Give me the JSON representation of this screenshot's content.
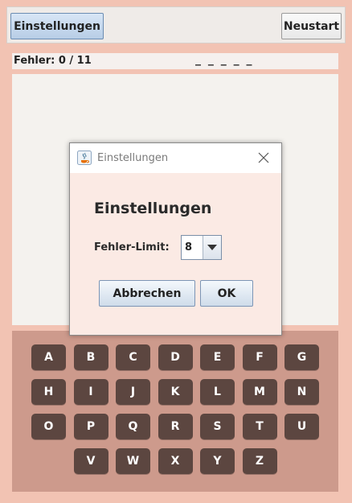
{
  "toolbar": {
    "settings_label": "Einstellungen",
    "restart_label": "Neustart"
  },
  "status": {
    "errors_label": "Fehler: 0 / 11",
    "word_display": "_ _ _ _ _"
  },
  "keyboard": {
    "rows": [
      [
        "A",
        "B",
        "C",
        "D",
        "E",
        "F",
        "G"
      ],
      [
        "H",
        "I",
        "J",
        "K",
        "L",
        "M",
        "N"
      ],
      [
        "O",
        "P",
        "Q",
        "R",
        "S",
        "T",
        "U"
      ],
      [
        "V",
        "W",
        "X",
        "Y",
        "Z"
      ]
    ]
  },
  "dialog": {
    "window_title": "Einstellungen",
    "heading": "Einstellungen",
    "limit_label": "Fehler-Limit:",
    "limit_value": "8",
    "cancel_label": "Abbrechen",
    "ok_label": "OK",
    "close_icon": "close-icon",
    "app_icon": "java-icon"
  },
  "colors": {
    "background": "#f2c3b3",
    "keyboard_bg": "#cd9a8c",
    "key_bg": "#5c4640",
    "dialog_bg": "#fbeae4"
  }
}
